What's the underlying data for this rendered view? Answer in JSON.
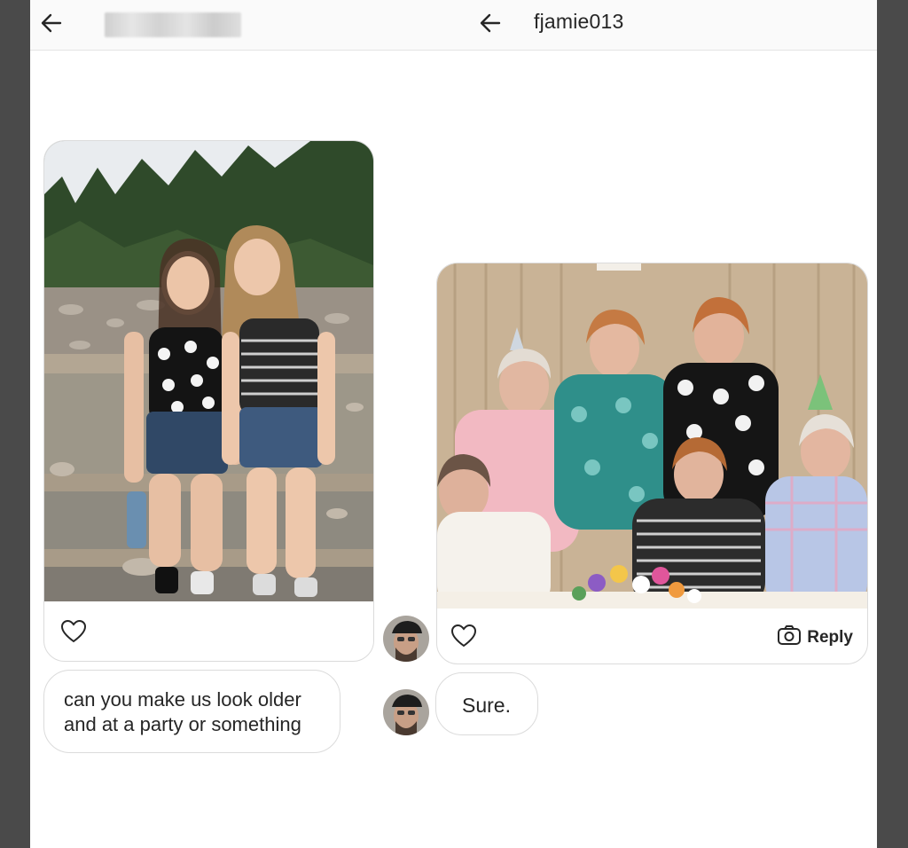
{
  "left_panel": {
    "sender_name": "",
    "messages": [
      {
        "type": "photo",
        "description_icon": "photo-two-girls"
      },
      {
        "type": "text",
        "lines": [
          "can you make us look older",
          "and at a party or something"
        ]
      }
    ]
  },
  "right_panel": {
    "username": "fjamie013",
    "messages": [
      {
        "type": "photo",
        "reply_label": "Reply"
      },
      {
        "type": "text",
        "text": "Sure."
      }
    ]
  },
  "colors": {
    "background": "#ffffff",
    "frame": "#4a4a4a",
    "border": "#dbdbdb",
    "text": "#262626"
  },
  "icons": [
    "back-arrow-icon",
    "heart-icon",
    "camera-icon"
  ]
}
